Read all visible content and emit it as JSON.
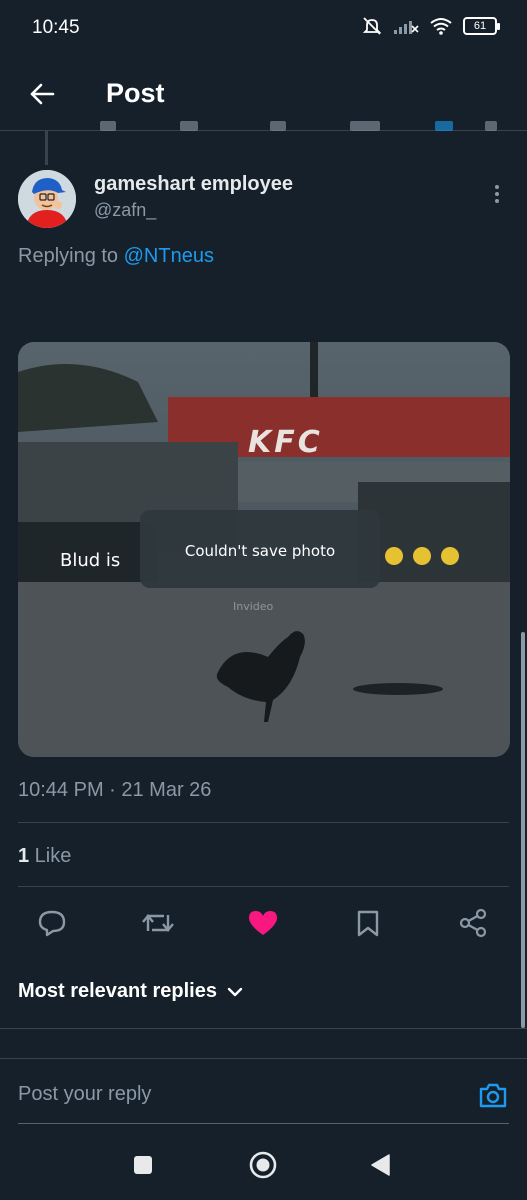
{
  "status_bar": {
    "time": "10:45",
    "battery": "61",
    "icons": [
      "mute-icon",
      "signal-icon",
      "wifi-icon",
      "battery-icon"
    ]
  },
  "header": {
    "title": "Post",
    "back_icon": "arrow-left-icon"
  },
  "post": {
    "author_name": "gameshart employee",
    "author_handle": "@zafn_",
    "replying_prefix": "Replying to ",
    "replying_to": "@NTneus",
    "media": {
      "sign_text": "KFC",
      "caption_text": "Blud is",
      "toast_text": "Couldn't save photo",
      "watermark": "Invideo"
    },
    "timestamp": "10:44 PM · 21 Mar 26",
    "likes_count": "1",
    "likes_label": " Like",
    "liked": true
  },
  "actions": [
    "reply-icon",
    "repost-icon",
    "like-icon",
    "bookmark-icon",
    "share-icon"
  ],
  "replies": {
    "sort_label": "Most relevant replies"
  },
  "composer": {
    "placeholder": "Post your reply"
  },
  "colors": {
    "background": "#15202b",
    "accent": "#1d9bf0",
    "like": "#f91880",
    "muted": "#8b98a5"
  }
}
